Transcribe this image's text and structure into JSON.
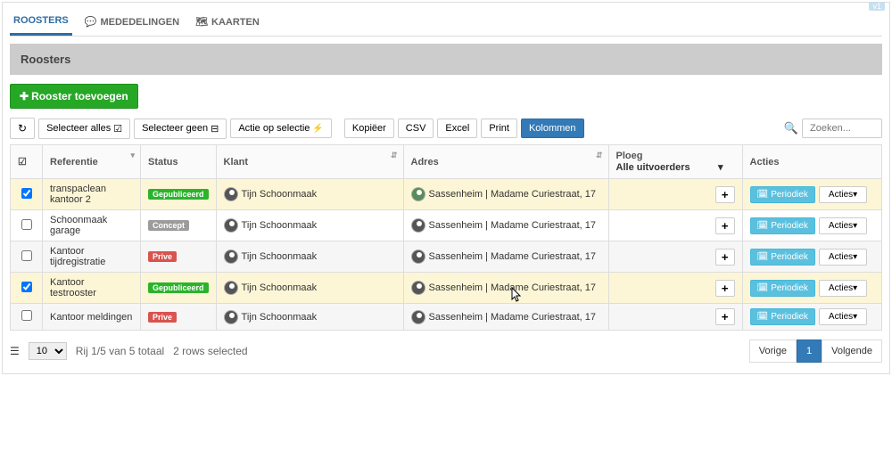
{
  "topbadge": "v1",
  "tabs": [
    {
      "label": "ROOSTERS",
      "icon": "",
      "active": true
    },
    {
      "label": "MEDEDELINGEN",
      "icon": "💬",
      "active": false
    },
    {
      "label": "KAARTEN",
      "icon": "🗺",
      "active": false
    }
  ],
  "header_title": "Roosters",
  "add_button": "Rooster toevoegen",
  "toolbar": {
    "refresh": "↻",
    "select_all": "Selecteer alles",
    "select_none": "Selecteer geen",
    "bulk_action": "Actie op selectie",
    "copy": "Kopiëer",
    "csv": "CSV",
    "excel": "Excel",
    "print": "Print",
    "columns": "Kolommen",
    "search_placeholder": "Zoeken..."
  },
  "columns": {
    "checkbox": "☑",
    "referentie": "Referentie",
    "status": "Status",
    "klant": "Klant",
    "adres": "Adres",
    "ploeg": "Ploeg",
    "acties": "Acties"
  },
  "ploeg_filter": "Alle uitvoerders",
  "rows": [
    {
      "selected": true,
      "ref": "transpaclean kantoor 2",
      "status_text": "Gepubliceerd",
      "status_cls": "pill-green",
      "klant": "Tijn Schoonmaak",
      "avatar_cls": "",
      "adres_avatar_cls": "green",
      "adres": "Sassenheim | Madame Curiestraat, 17"
    },
    {
      "selected": false,
      "ref": "Schoonmaak garage",
      "status_text": "Concept",
      "status_cls": "pill-grey",
      "klant": "Tijn Schoonmaak",
      "avatar_cls": "",
      "adres_avatar_cls": "",
      "adres": "Sassenheim | Madame Curiestraat, 17"
    },
    {
      "selected": false,
      "ref": "Kantoor tijdregistratie",
      "status_text": "Prive",
      "status_cls": "pill-red",
      "klant": "Tijn Schoonmaak",
      "avatar_cls": "",
      "adres_avatar_cls": "",
      "adres": "Sassenheim | Madame Curiestraat, 17"
    },
    {
      "selected": true,
      "ref": "Kantoor testrooster",
      "status_text": "Gepubliceerd",
      "status_cls": "pill-green",
      "klant": "Tijn Schoonmaak",
      "avatar_cls": "",
      "adres_avatar_cls": "",
      "adres": "Sassenheim | Madame Curiestraat, 17"
    },
    {
      "selected": false,
      "ref": "Kantoor meldingen",
      "status_text": "Prive",
      "status_cls": "pill-red",
      "klant": "Tijn Schoonmaak",
      "avatar_cls": "",
      "adres_avatar_cls": "",
      "adres": "Sassenheim | Madame Curiestraat, 17"
    }
  ],
  "action_period": "Periodiek",
  "action_menu": "Acties",
  "footer": {
    "page_size": "10",
    "range": "Rij 1/5 van 5 totaal",
    "selected": "2 rows selected",
    "prev": "Vorige",
    "page": "1",
    "next": "Volgende"
  }
}
